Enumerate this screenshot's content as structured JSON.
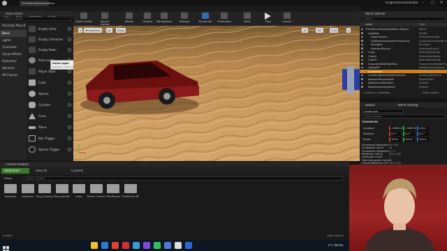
{
  "app": {
    "doc_tab": "ThirdPersonExampleMap",
    "project_title": "KingOsmosisSimulator"
  },
  "menu": [
    "File",
    "Edit",
    "Window",
    "Help"
  ],
  "place_actors": {
    "tab": "Place Actors",
    "search_placeholder": "Search Classes",
    "categories": [
      "Recently Placed",
      "Basic",
      "Lights",
      "Cinematic",
      "Visual Effects",
      "Geometry",
      "Volumes",
      "All Classes"
    ],
    "selected_category": "Basic",
    "items": [
      "Empty Actor",
      "Empty Character",
      "Empty Pawn",
      "Point Light",
      "Player Start",
      "Cube",
      "Sphere",
      "Cylinder",
      "Cone",
      "Plane",
      "Box Trigger",
      "Sphere Trigger"
    ]
  },
  "tooltip": {
    "title": "Point Light",
    "body": "Hold Ctrl + Alt for more"
  },
  "toolbar": {
    "buttons": [
      "Save Current",
      "Source Control",
      "Modes",
      "Content",
      "Marketplace",
      "Settings",
      "Blueprints",
      "Cinematics",
      "Build",
      "Play",
      "Launch"
    ]
  },
  "viewport": {
    "perspective": "Perspective",
    "lit": "Lit",
    "show": "Show",
    "grid_value": "10",
    "angle_value": "10°",
    "scale_value": "0.25",
    "speed_value": "4"
  },
  "outliner": {
    "tab": "World Outliner",
    "search_placeholder": "Search...",
    "col_label": "Label",
    "col_type": "Type",
    "rows": [
      {
        "label": "ThirdPersonExampleMap (Editor)",
        "type": "World"
      },
      {
        "label": "Lighting",
        "type": "Folder"
      },
      {
        "label": "Light Source",
        "type": "DirectionalLight"
      },
      {
        "label": "LightmassImportanceVolume",
        "type": "LightmassImportance"
      },
      {
        "label": "SkyLight",
        "type": "SkyLight"
      },
      {
        "label": "AmbientSound",
        "type": "AmbientSound"
      },
      {
        "label": "Cube",
        "type": "StaticMeshActor"
      },
      {
        "label": "Cube2",
        "type": "StaticMeshActor"
      },
      {
        "label": "Cube3",
        "type": "StaticMeshActor"
      },
      {
        "label": "ExponentialHeightFog",
        "type": "ExponentialHeightFog"
      },
      {
        "label": "GlobalPP",
        "type": "PostProcessVolume"
      },
      {
        "label": "Landscape",
        "type": "Landscape"
      },
      {
        "label": "LandscapeGizmoActiveActor",
        "type": "LandscapeGizmo"
      },
      {
        "label": "NetworkPlayerStart",
        "type": "PlayerStart"
      },
      {
        "label": "NewParticleSystem",
        "type": "Emitter"
      },
      {
        "label": "NewParticleSystem2",
        "type": "Emitter"
      }
    ],
    "selected_label": "Landscape",
    "status": "12 actors (1 selected)",
    "view_options": "View Options"
  },
  "details": {
    "tab": "Details",
    "world_settings_tab": "World Settings",
    "actor_name": "Landscape",
    "search_placeholder": "Search Details",
    "transform": "Transform",
    "location_label": "Location",
    "rotation_label": "Rotation",
    "scale_label": "Scale",
    "location": [
      "-25600.0",
      "-25600.0",
      "100.0"
    ],
    "rotation": [
      "0.0 °",
      "0.0 °",
      "0.0 °"
    ],
    "scale": [
      "100.0",
      "100.0",
      "100.0"
    ],
    "landscape_rows": [
      {
        "k": "Component Resolution",
        "v": "63 x 63"
      },
      {
        "k": "Component Count",
        "v": "64"
      },
      {
        "k": "Component Subsection",
        "v": "1 x 1"
      },
      {
        "k": "Resolution (Verts)",
        "v": "505 x 505"
      },
      {
        "k": "Landscape Count",
        "v": "1"
      },
      {
        "k": "Total Component Count",
        "v": "64"
      },
      {
        "k": "Overall Resolution (Ve",
        "v": "505 x 505"
      }
    ]
  },
  "content_browser": {
    "tab": "Content Browser",
    "add_import": "Add/Import",
    "save_all": "Save All",
    "path": "Content",
    "filters": "Filters",
    "search_placeholder": "Search Content",
    "folders": [
      "Geometry",
      "Geometry",
      "King_Osmosis",
      "MannequinRt",
      "maps",
      "Starter Content",
      "ThirdPerson",
      "ThirdPerson BP"
    ],
    "item_count": "8 items",
    "view_options": "View Options"
  },
  "taskbar": {
    "weather": "6°C  Mostly",
    "icon_colors": [
      "#f0c030",
      "#2a7ad8",
      "#e84030",
      "#d03030",
      "#3a9ad8",
      "#7a4ad8",
      "#30c060",
      "#4a7ad8",
      "#dddddd",
      "#2a6ad0"
    ]
  },
  "colors": {
    "accent_orange": "#c96a12",
    "play_green": "#4a9a3a",
    "selected_row": "#d17e17"
  }
}
